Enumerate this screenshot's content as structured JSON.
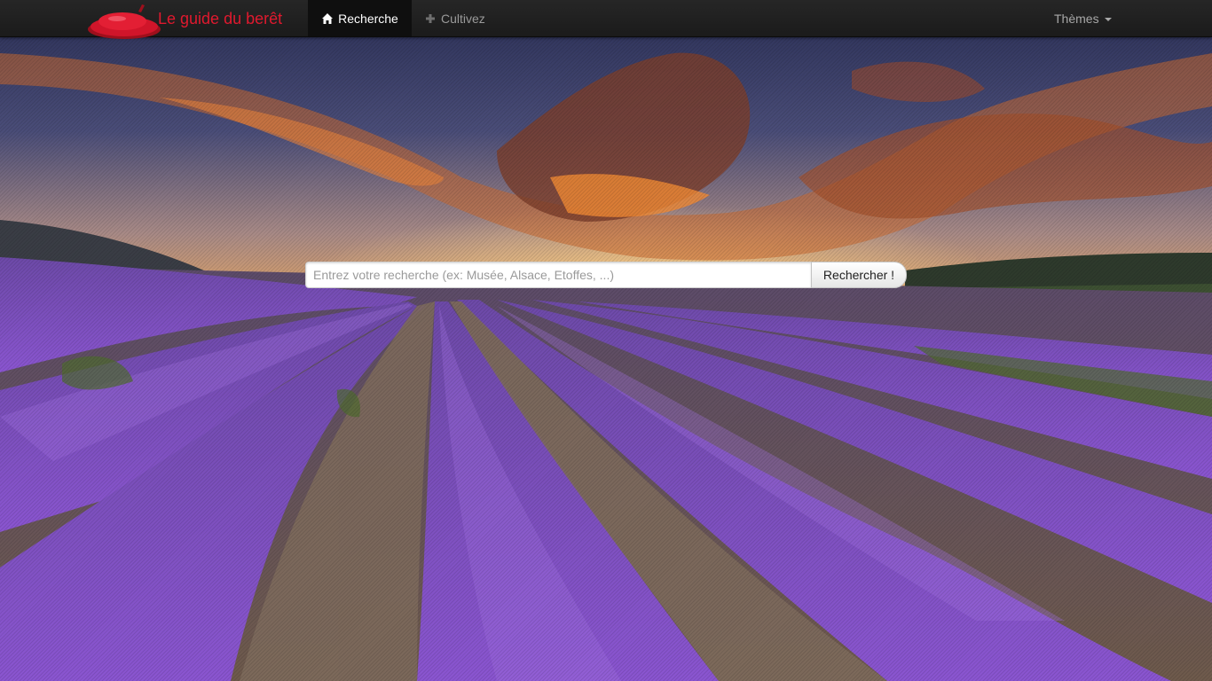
{
  "brand": {
    "name": "Le guide du berêt",
    "logo_icon": "beret-icon",
    "color": "#e0192e"
  },
  "nav": {
    "items": [
      {
        "label": "Recherche",
        "icon": "home-icon",
        "active": true
      },
      {
        "label": "Cultivez",
        "icon": "plus-icon",
        "active": false
      }
    ],
    "themes": {
      "label": "Thèmes",
      "icon": "caret-down-icon"
    }
  },
  "search": {
    "placeholder": "Entrez votre recherche (ex: Musée, Alsace, Etoffes, ...)",
    "value": "",
    "button_label": "Rechercher !"
  },
  "background": {
    "subject": "lavender-field-sunset",
    "colors": {
      "sky": "#3a4268",
      "clouds": "#e07a2c",
      "lavender": "#7a4fc0",
      "soil": "#6b5a4c"
    }
  }
}
